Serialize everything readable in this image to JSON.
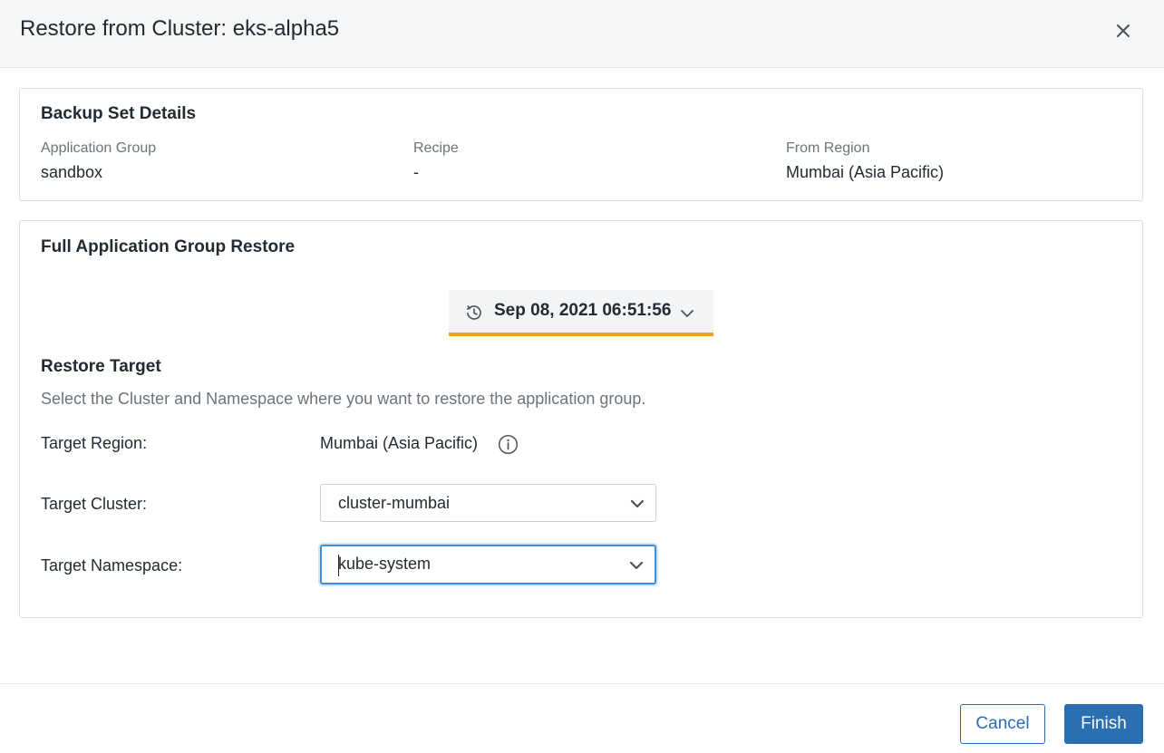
{
  "dialog": {
    "title": "Restore from Cluster: eks-alpha5",
    "close_icon": "close-icon"
  },
  "backup_set": {
    "title": "Backup Set Details",
    "fields": [
      {
        "label": "Application Group",
        "value": "sandbox"
      },
      {
        "label": "Recipe",
        "value": "-"
      },
      {
        "label": "From Region",
        "value": "Mumbai (Asia Pacific)"
      }
    ]
  },
  "restore": {
    "title": "Full Application Group Restore",
    "snapshot": {
      "value": "Sep 08, 2021 06:51:56",
      "icon": "history-icon"
    },
    "target_title": "Restore Target",
    "help_text": "Select the Cluster and Namespace where you want to restore the application group.",
    "region": {
      "label": "Target Region:",
      "value": "Mumbai (Asia Pacific)",
      "icon": "info-icon"
    },
    "cluster": {
      "label": "Target Cluster:",
      "value": "cluster-mumbai"
    },
    "namespace": {
      "label": "Target Namespace:",
      "value": "kube-system"
    }
  },
  "footer": {
    "cancel_label": "Cancel",
    "finish_label": "Finish"
  },
  "colors": {
    "accent": "#2b6fb3",
    "highlight": "#f0a01e",
    "focus": "#3c8fd8"
  }
}
